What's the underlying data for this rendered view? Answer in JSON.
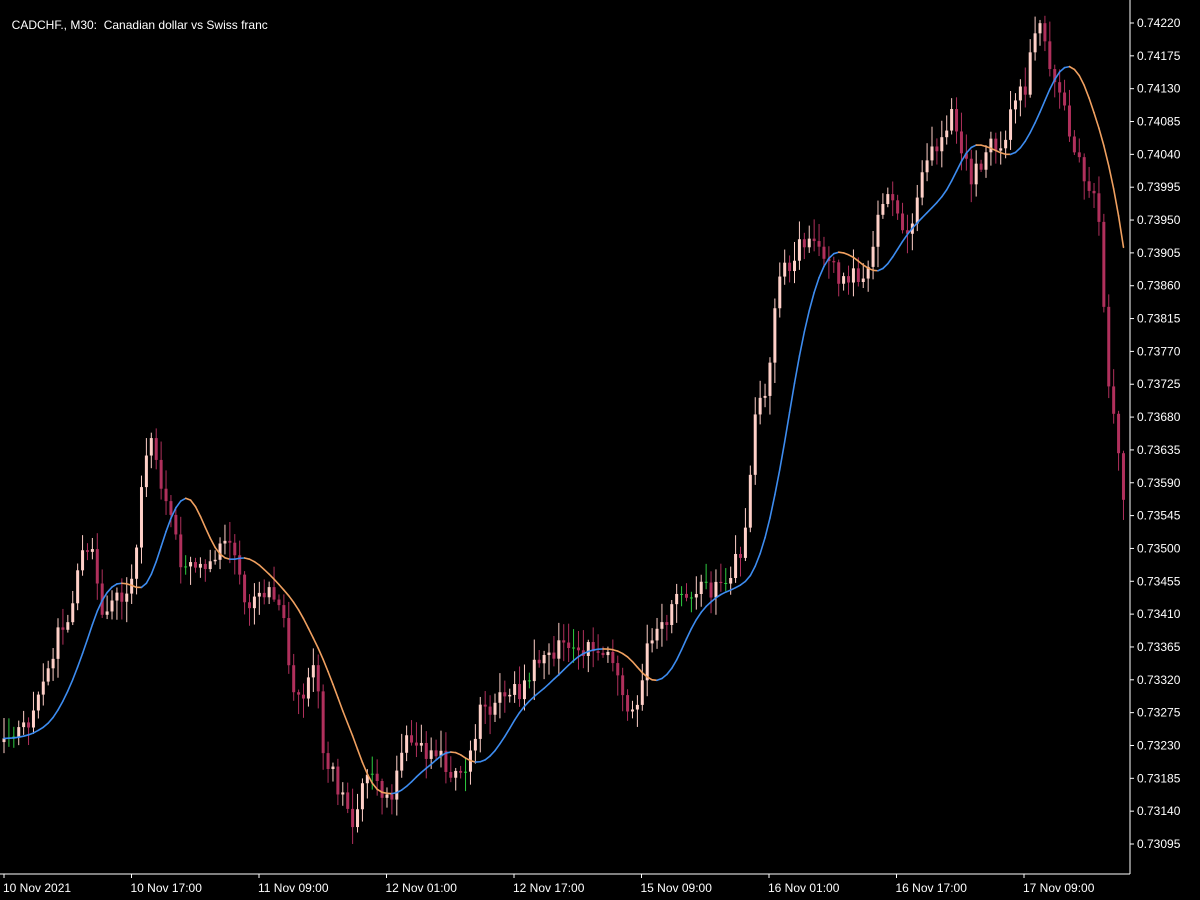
{
  "header": {
    "symbol_timeframe": "CADCHF., M30:",
    "description": "Canadian dollar vs Swiss franc"
  },
  "colors": {
    "background": "#000000",
    "axis": "#ffffff",
    "candle_bull": "#ffd0c8",
    "candle_bear": "#b0305c",
    "candle_doji_green": "#2ecc40",
    "ma_rising": "#3d8cf0",
    "ma_falling": "#f0a060"
  },
  "chart_data": {
    "type": "candlestick",
    "y_axis": {
      "position": "right",
      "range": [
        0.7306,
        0.74245
      ],
      "ticks": [
        "0.74220",
        "0.74175",
        "0.74130",
        "0.74085",
        "0.74040",
        "0.73995",
        "0.73950",
        "0.73905",
        "0.73860",
        "0.73815",
        "0.73770",
        "0.73725",
        "0.73680",
        "0.73635",
        "0.73590",
        "0.73545",
        "0.73500",
        "0.73455",
        "0.73410",
        "0.73365",
        "0.73320",
        "0.73275",
        "0.73230",
        "0.73185",
        "0.73140",
        "0.73095"
      ]
    },
    "x_axis": {
      "position": "bottom",
      "ticks": [
        "10 Nov 2021",
        "10 Nov 17:00",
        "11 Nov 09:00",
        "12 Nov 01:00",
        "12 Nov 17:00",
        "15 Nov 09:00",
        "16 Nov 01:00",
        "16 Nov 17:00",
        "17 Nov 09:00"
      ]
    },
    "close_path": [
      {
        "i": 0,
        "v": 0.7324
      },
      {
        "i": 4,
        "v": 0.7326
      },
      {
        "i": 8,
        "v": 0.73315
      },
      {
        "i": 12,
        "v": 0.7339
      },
      {
        "i": 17,
        "v": 0.73505
      },
      {
        "i": 21,
        "v": 0.7341
      },
      {
        "i": 25,
        "v": 0.7344
      },
      {
        "i": 30,
        "v": 0.7364
      },
      {
        "i": 33,
        "v": 0.7356
      },
      {
        "i": 37,
        "v": 0.7347
      },
      {
        "i": 41,
        "v": 0.7348
      },
      {
        "i": 45,
        "v": 0.735
      },
      {
        "i": 50,
        "v": 0.7343
      },
      {
        "i": 55,
        "v": 0.7344
      },
      {
        "i": 60,
        "v": 0.733
      },
      {
        "i": 63,
        "v": 0.7333
      },
      {
        "i": 66,
        "v": 0.732
      },
      {
        "i": 71,
        "v": 0.7313
      },
      {
        "i": 74,
        "v": 0.7319
      },
      {
        "i": 78,
        "v": 0.7316
      },
      {
        "i": 82,
        "v": 0.7323
      },
      {
        "i": 87,
        "v": 0.73225
      },
      {
        "i": 93,
        "v": 0.7319
      },
      {
        "i": 98,
        "v": 0.7328
      },
      {
        "i": 104,
        "v": 0.733
      },
      {
        "i": 110,
        "v": 0.7335
      },
      {
        "i": 116,
        "v": 0.7337
      },
      {
        "i": 122,
        "v": 0.7336
      },
      {
        "i": 128,
        "v": 0.7328
      },
      {
        "i": 132,
        "v": 0.7338
      },
      {
        "i": 138,
        "v": 0.7343
      },
      {
        "i": 142,
        "v": 0.7344
      },
      {
        "i": 147,
        "v": 0.7346
      },
      {
        "i": 150,
        "v": 0.735
      },
      {
        "i": 154,
        "v": 0.737
      },
      {
        "i": 159,
        "v": 0.7388
      },
      {
        "i": 163,
        "v": 0.7392
      },
      {
        "i": 167,
        "v": 0.73895
      },
      {
        "i": 171,
        "v": 0.7387
      },
      {
        "i": 175,
        "v": 0.7388
      },
      {
        "i": 180,
        "v": 0.7399
      },
      {
        "i": 184,
        "v": 0.73925
      },
      {
        "i": 189,
        "v": 0.7405
      },
      {
        "i": 193,
        "v": 0.7409
      },
      {
        "i": 197,
        "v": 0.7401
      },
      {
        "i": 203,
        "v": 0.7406
      },
      {
        "i": 207,
        "v": 0.7412
      },
      {
        "i": 211,
        "v": 0.7421
      },
      {
        "i": 214,
        "v": 0.7415
      },
      {
        "i": 218,
        "v": 0.7404
      },
      {
        "i": 222,
        "v": 0.7398
      },
      {
        "i": 226,
        "v": 0.7369
      },
      {
        "i": 228,
        "v": 0.7357
      }
    ]
  }
}
